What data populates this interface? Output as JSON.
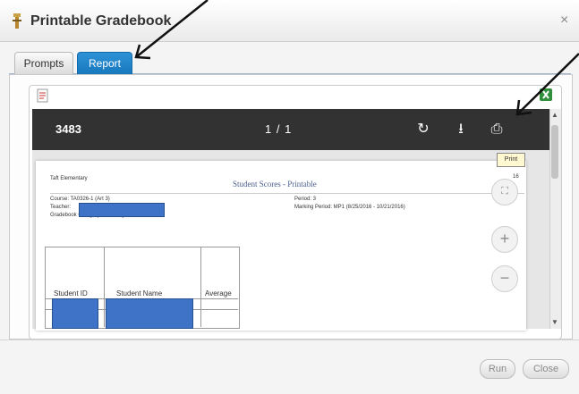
{
  "dialog": {
    "title": "Printable Gradebook",
    "close_glyph": "×"
  },
  "tabs": [
    {
      "label": "Prompts"
    },
    {
      "label": "Report"
    }
  ],
  "pdf_toolbar": {
    "document_name": "3483",
    "page_indicator": "1 / 1",
    "rotate_glyph": "↻",
    "download_glyph": "⭳",
    "print_glyph": "⎙",
    "print_tooltip": "Print"
  },
  "report": {
    "school": "Taft Elementary",
    "title": "Student Scores - Printable",
    "page_num_fragment": "16",
    "course": "Course:   TA0326-1 (Art 3)",
    "teacher": "Teacher:",
    "category": "Gradebook Category:  All Categories",
    "period": "Period:  3",
    "marking_period": "Marking Period:  MP1 (8/25/2016 - 10/21/2016)",
    "columns": [
      "Student ID",
      "Student Name",
      "Average"
    ]
  },
  "zoom": {
    "fit_glyph": "⛶",
    "in_glyph": "+",
    "out_glyph": "−"
  },
  "footer": {
    "run_label": "Run",
    "close_label": "Close"
  },
  "colors": {
    "tab_active": "#1877bd",
    "pdf_toolbar": "#323232",
    "redaction": "#3e73c8"
  }
}
